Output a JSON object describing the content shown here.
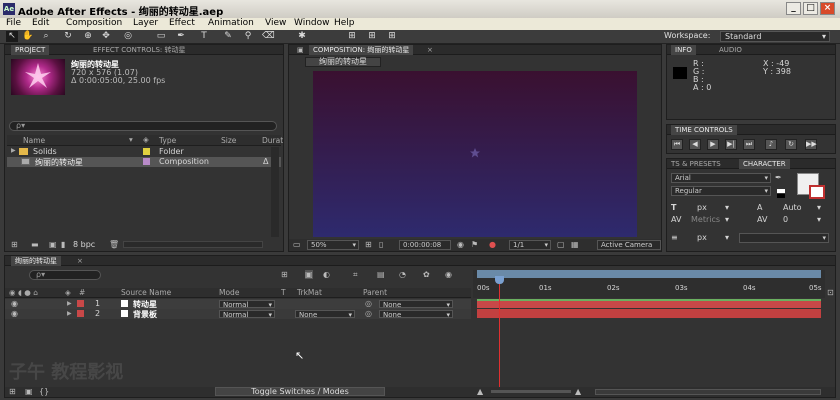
{
  "window": {
    "title": "Adobe After Effects - 绚丽的转动星.aep"
  },
  "menu": [
    "File",
    "Edit",
    "Composition",
    "Layer",
    "Effect",
    "Animation",
    "View",
    "Window",
    "Help"
  ],
  "workspace": {
    "label": "Workspace:",
    "value": "Standard"
  },
  "project_panel": {
    "tabs": [
      "PROJECT",
      "EFFECT CONTROLS: 转动星"
    ],
    "item_name": "绚丽的转动星",
    "item_size": "720 x 576 (1.07)",
    "item_duration": "Δ 0:00:05:00, 25.00 fps",
    "search_placeholder": "ρ▾",
    "columns": [
      "Name",
      "Type",
      "Size",
      "Durat"
    ],
    "rows": [
      {
        "name": "Solids",
        "type": "Folder",
        "size": "",
        "dur": ""
      },
      {
        "name": "绚丽的转动星",
        "type": "Composition",
        "size": "",
        "dur": "Δ"
      }
    ],
    "bpc": "8 bpc"
  },
  "comp_panel": {
    "tab": "COMPOSITION: 绚丽的转动星",
    "crumb": "绚丽的转动星",
    "zoom": "50%",
    "timecode": "0:00:00:08",
    "resolution": "1/1",
    "camera": "Active Camera"
  },
  "info_panel": {
    "tabs": [
      "INFO",
      "AUDIO"
    ],
    "r": "R :",
    "g": "G :",
    "b": "B :",
    "a": "A : 0",
    "x": "X : -49",
    "y": "Y : 398"
  },
  "time_controls": {
    "tab": "TIME CONTROLS"
  },
  "character_panel": {
    "tabs": [
      "TS & PRESETS",
      "CHARACTER"
    ],
    "font": "Arial",
    "style": "Regular",
    "size_unit": "px",
    "leading": "Auto",
    "kerning": "Metrics",
    "tracking": "0",
    "stroke_unit": "px"
  },
  "timeline": {
    "tab": "绚丽的转动星",
    "search_placeholder": "ρ▾",
    "col_headers": {
      "source": "Source Name",
      "mode": "Mode",
      "t": "T",
      "trkmat": "TrkMat",
      "parent": "Parent"
    },
    "layers": [
      {
        "num": "1",
        "name": "转动星",
        "mode": "Normal",
        "trkmat": "",
        "parent": "None"
      },
      {
        "num": "2",
        "name": "背景板",
        "mode": "Normal",
        "trkmat": "None",
        "parent": "None"
      }
    ],
    "ruler": [
      "00s",
      "01s",
      "02s",
      "03s",
      "04s",
      "05s"
    ],
    "toggle": "Toggle Switches / Modes"
  },
  "watermark": "子午 教程影视",
  "colors": {
    "comp_top": "#3a1030",
    "comp_bottom": "#2e2a6e",
    "layer1_bar": "#c84848",
    "layer2_bar": "#c24040",
    "cti": "#e03030",
    "work_area": "#6a8aa8"
  }
}
